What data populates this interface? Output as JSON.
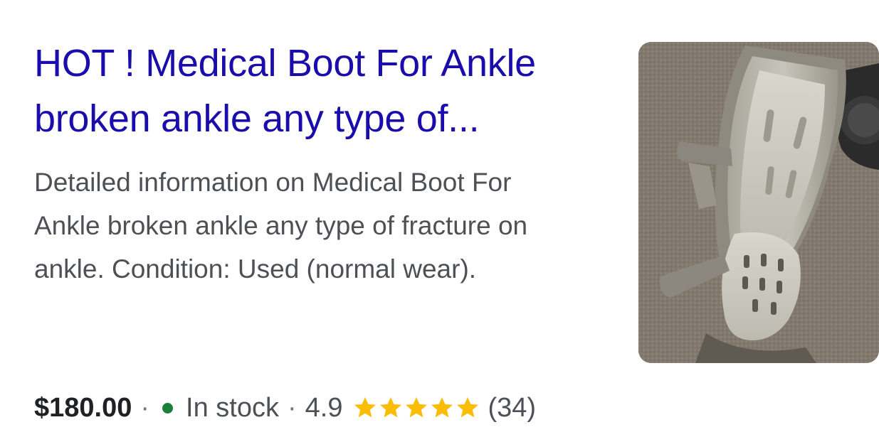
{
  "result": {
    "title_line1": "HOT ! Medical Boot For Ankle",
    "title_line2": "broken ankle any type of...",
    "snippet_line1": "Detailed information on Medical Boot For",
    "snippet_line2": "Ankle broken ankle any type of fracture on",
    "snippet_line3": "ankle. Condition: Used (normal wear).",
    "price": "$180.00",
    "separator": "·",
    "stock": "In stock",
    "rating": "4.9",
    "rating_count": "(34)",
    "stars_filled": 5,
    "stars_total": 5,
    "thumbnail_icon": "product-photo-medical-boot"
  },
  "colors": {
    "title_link": "#1a0dab",
    "snippet_text": "#4d5156",
    "price_text": "#202124",
    "in_stock_dot": "#188038",
    "star": "#fbbc04"
  }
}
